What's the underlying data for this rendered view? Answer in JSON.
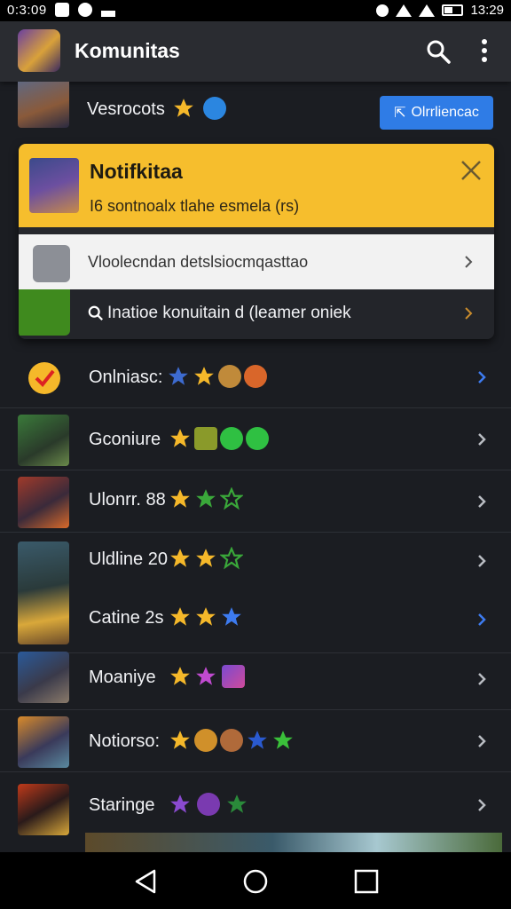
{
  "status": {
    "time": "0:3:09",
    "clock": "13:29"
  },
  "app": {
    "title": "Komunitas"
  },
  "top_row": {
    "label": "Vesrocots",
    "button": "Olrrliencac"
  },
  "notification": {
    "title": "Notifkitaa",
    "subtitle": "I6 sontnoalx tlahe esmela (rs)",
    "item1": "Vloolecndan detslsiocmqasttao",
    "item2": "Inatioe konuitain d (leamer oniek"
  },
  "rows": [
    {
      "label": "Onlniasc:",
      "chevron_color": "#3d7bf0"
    },
    {
      "label": "Gconiure",
      "chevron_color": "#b9bcc2"
    },
    {
      "label": "Ulonrr. 88",
      "chevron_color": "#b9bcc2"
    },
    {
      "label": "Uldline 20",
      "chevron_color": "#b9bcc2"
    },
    {
      "label": "Catine 2s",
      "chevron_color": "#3d7bf0"
    },
    {
      "label": "Moaniye",
      "chevron_color": "#b9bcc2"
    },
    {
      "label": "Notiorso:",
      "chevron_color": "#b9bcc2"
    },
    {
      "label": "Staringe",
      "chevron_color": "#b9bcc2"
    }
  ],
  "colors": {
    "accent": "#2f7ce6",
    "notification": "#f6be2d",
    "background": "#1b1d22"
  },
  "icons": [
    "search-icon",
    "more-vert-icon",
    "close-icon",
    "chevron-right-icon",
    "back-icon",
    "home-icon",
    "recents-icon"
  ]
}
